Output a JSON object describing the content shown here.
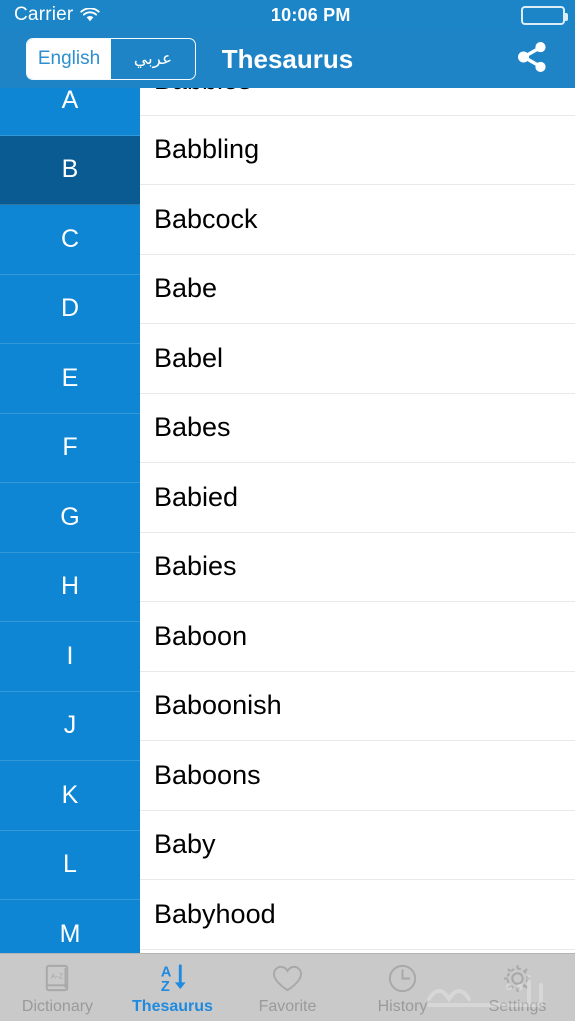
{
  "status_bar": {
    "carrier": "Carrier",
    "wifi_icon": "wifi-icon",
    "time": "10:06 PM",
    "battery_icon": "battery-full-icon"
  },
  "nav_bar": {
    "title": "Thesaurus",
    "language_segments": [
      {
        "label": "English",
        "selected": true
      },
      {
        "label": "عربي",
        "selected": false
      }
    ],
    "share_icon": "share-icon"
  },
  "alphabet_rail": {
    "selected_letter": "B",
    "letters": [
      "A",
      "B",
      "C",
      "D",
      "E",
      "F",
      "G",
      "H",
      "I",
      "J",
      "K",
      "L",
      "M"
    ]
  },
  "word_list": {
    "words": [
      "Babbles",
      "Babbling",
      "Babcock",
      "Babe",
      "Babel",
      "Babes",
      "Babied",
      "Babies",
      "Baboon",
      "Baboonish",
      "Baboons",
      "Baby",
      "Babyhood"
    ]
  },
  "tab_bar": {
    "active_tab": "Thesaurus",
    "tabs": [
      {
        "label": "Dictionary",
        "icon": "dictionary-book-icon",
        "active": false
      },
      {
        "label": "Thesaurus",
        "icon": "az-sort-icon",
        "active": true
      },
      {
        "label": "Favorite",
        "icon": "heart-icon",
        "active": false
      },
      {
        "label": "History",
        "icon": "clock-icon",
        "active": false
      },
      {
        "label": "Settings",
        "icon": "gear-icon",
        "active": false
      }
    ]
  },
  "colors": {
    "status_bar_blue": "#1b85c8",
    "nav_bar_blue": "#1e84c6",
    "rail_blue": "#0e86d4",
    "rail_selected_blue": "#0a5b92",
    "tab_bar_gray": "#c9c9c9",
    "tab_active_blue": "#1e8ae0",
    "tab_inactive_gray": "#9a9a9a"
  }
}
